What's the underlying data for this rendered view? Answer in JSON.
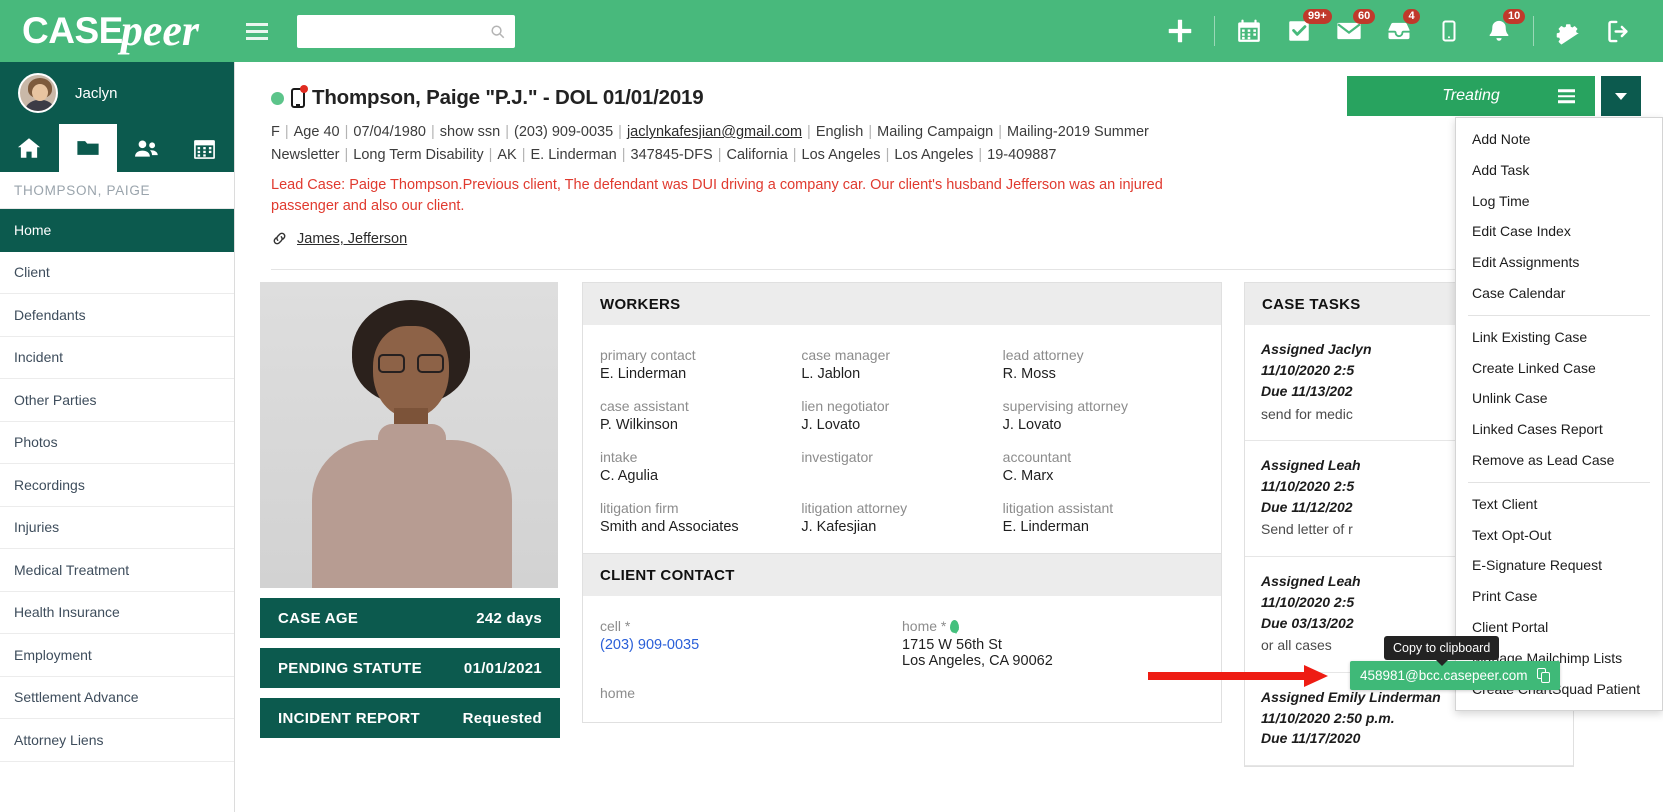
{
  "brand": {
    "part1": "CASE",
    "part2": "peer"
  },
  "topbar": {
    "search_placeholder": "",
    "search_value": "",
    "icons": [
      {
        "name": "plus-icon",
        "badge": ""
      },
      {
        "name": "calendar-icon",
        "badge": ""
      },
      {
        "name": "tasks-check-icon",
        "badge": "99+"
      },
      {
        "name": "envelope-icon",
        "badge": "60"
      },
      {
        "name": "inbox-icon",
        "badge": "4"
      },
      {
        "name": "mobile-icon",
        "badge": ""
      },
      {
        "name": "bell-icon",
        "badge": "10"
      },
      {
        "name": "gear-icon",
        "badge": ""
      },
      {
        "name": "logout-icon",
        "badge": ""
      }
    ]
  },
  "sidebar": {
    "user_name": "Jaclyn",
    "tabs": [
      {
        "name": "home-tab",
        "icon": "house-icon",
        "active": false
      },
      {
        "name": "cases-tab",
        "icon": "folder-icon",
        "active": true
      },
      {
        "name": "contacts-tab",
        "icon": "people-icon",
        "active": false
      },
      {
        "name": "calendar-tab",
        "icon": "calendar-icon",
        "active": false
      }
    ],
    "case_label": "THOMPSON, PAIGE",
    "items": [
      {
        "label": "Home",
        "active": true
      },
      {
        "label": "Client",
        "active": false
      },
      {
        "label": "Defendants",
        "active": false
      },
      {
        "label": "Incident",
        "active": false
      },
      {
        "label": "Other Parties",
        "active": false
      },
      {
        "label": "Photos",
        "active": false
      },
      {
        "label": "Recordings",
        "active": false
      },
      {
        "label": "Injuries",
        "active": false
      },
      {
        "label": "Medical Treatment",
        "active": false
      },
      {
        "label": "Health Insurance",
        "active": false
      },
      {
        "label": "Employment",
        "active": false
      },
      {
        "label": "Settlement Advance",
        "active": false
      },
      {
        "label": "Attorney Liens",
        "active": false
      }
    ]
  },
  "case_header": {
    "title": "Thompson, Paige \"P.J.\" - DOL 01/01/2019",
    "meta": [
      "F",
      "Age 40",
      "07/04/1980",
      "show ssn",
      "(203) 909-0035",
      "jaclynkafesjian@gmail.com",
      "English",
      "Mailing Campaign",
      "Mailing-2019 Summer Newsletter",
      "Long Term Disability",
      "AK",
      "E. Linderman",
      "347845-DFS",
      "California",
      "Los Angeles",
      "Los Angeles",
      "19-409887"
    ],
    "email_index": 5,
    "lead_note": "Lead Case: Paige Thompson.Previous client, The defendant was DUI driving a company car. Our client's husband Jefferson was an injured passenger and also our client.",
    "linked_case": "James, Jefferson",
    "status_label": "Treating"
  },
  "dropdown": {
    "groups": [
      [
        "Add Note",
        "Add Task",
        "Log Time",
        "Edit Case Index",
        "Edit Assignments",
        "Case Calendar"
      ],
      [
        "Link Existing Case",
        "Create Linked Case",
        "Unlink Case",
        "Linked Cases Report",
        "Remove as Lead Case"
      ],
      [
        "Text Client",
        "Text Opt-Out",
        "E-Signature Request",
        "Print Case",
        "Client Portal",
        "Manage Mailchimp Lists",
        "Create ChartSquad Patient"
      ]
    ]
  },
  "tooltip": {
    "text": "Copy to clipboard"
  },
  "email_chip": {
    "address": "458981@bcc.casepeer.com",
    "icon": "copy-icon"
  },
  "kpis": [
    {
      "label": "CASE AGE",
      "value": "242 days"
    },
    {
      "label": "PENDING STATUTE",
      "value": "01/01/2021"
    },
    {
      "label": "INCIDENT REPORT",
      "value": "Requested"
    }
  ],
  "workers": {
    "title": "WORKERS",
    "fields": [
      {
        "label": "primary contact",
        "value": "E. Linderman"
      },
      {
        "label": "case manager",
        "value": "L. Jablon"
      },
      {
        "label": "lead attorney",
        "value": "R. Moss"
      },
      {
        "label": "case assistant",
        "value": "P. Wilkinson"
      },
      {
        "label": "lien negotiator",
        "value": "J. Lovato"
      },
      {
        "label": "supervising attorney",
        "value": "J. Lovato"
      },
      {
        "label": "intake",
        "value": "C. Agulia"
      },
      {
        "label": "investigator",
        "value": ""
      },
      {
        "label": "accountant",
        "value": "C. Marx"
      },
      {
        "label": "litigation firm",
        "value": "Smith and Associates"
      },
      {
        "label": "litigation attorney",
        "value": "J. Kafesjian"
      },
      {
        "label": "litigation assistant",
        "value": "E. Linderman"
      }
    ]
  },
  "client_contact": {
    "title": "CLIENT CONTACT",
    "cell_label": "cell *",
    "cell_value": "(203) 909-0035",
    "home_label": "home *",
    "home_addr1": "1715 W 56th St",
    "home_addr2": "Los Angeles, CA 90062",
    "home2_label": "home"
  },
  "case_tasks": {
    "title": "CASE TASKS",
    "items": [
      {
        "assigned": "Assigned Jaclyn",
        "created": "11/10/2020 2:5",
        "due": "Due 11/13/202",
        "body": "send for medic"
      },
      {
        "assigned": "Assigned Leah",
        "created": "11/10/2020 2:5",
        "due": "Due 11/12/202",
        "body": "Send letter of r"
      },
      {
        "assigned": "Assigned Leah",
        "created": "11/10/2020 2:5",
        "due": "Due 03/13/202",
        "body": "or all cases"
      },
      {
        "assigned": "Assigned Emily Linderman",
        "created": "11/10/2020 2:50 p.m.",
        "due": "Due 11/17/2020",
        "body": ""
      }
    ]
  }
}
